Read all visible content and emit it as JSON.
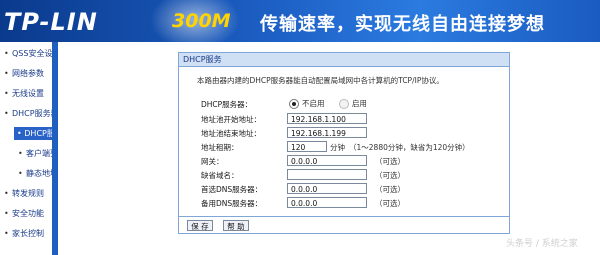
{
  "header": {
    "logo": "TP-LIN",
    "slogan_speed": "300M",
    "slogan_text": "传输速率，实现无线自由连接梦想"
  },
  "sidebar": {
    "items": [
      {
        "label": "QSS安全设置",
        "level": 0
      },
      {
        "label": "网络参数",
        "level": 0
      },
      {
        "label": "无线设置",
        "level": 0
      },
      {
        "label": "DHCP服务器",
        "level": 0
      },
      {
        "label": "DHCP服务",
        "level": 1,
        "active": true
      },
      {
        "label": "客户端列",
        "level": 1
      },
      {
        "label": "静态地址",
        "level": 1
      },
      {
        "label": "转发规则",
        "level": 0
      },
      {
        "label": "安全功能",
        "level": 0
      },
      {
        "label": "家长控制",
        "level": 0
      }
    ]
  },
  "panel": {
    "title": "DHCP服务",
    "description": "本路由器内建的DHCP服务器能自动配置局域网中各计算机的TCP/IP协议。",
    "dhcp_server": {
      "label": "DHCP服务器：",
      "options": [
        "不启用",
        "启用"
      ],
      "selected": "不启用"
    },
    "start_ip": {
      "label": "地址池开始地址：",
      "value": "192.168.1.100"
    },
    "end_ip": {
      "label": "地址池结束地址：",
      "value": "192.168.1.199"
    },
    "lease": {
      "label": "地址租期：",
      "value": "120",
      "unit": "分钟",
      "hint": "（1～2880分钟，缺省为120分钟）"
    },
    "gateway": {
      "label": "网关：",
      "value": "0.0.0.0",
      "hint": "（可选）"
    },
    "domain": {
      "label": "缺省域名：",
      "value": "",
      "hint": "（可选）"
    },
    "dns1": {
      "label": "首选DNS服务器：",
      "value": "0.0.0.0",
      "hint": "（可选）"
    },
    "dns2": {
      "label": "备用DNS服务器：",
      "value": "0.0.0.0",
      "hint": "（可选）"
    },
    "save_label": "保 存",
    "help_label": "帮 助"
  },
  "watermark": "头条号 / 系统之家"
}
